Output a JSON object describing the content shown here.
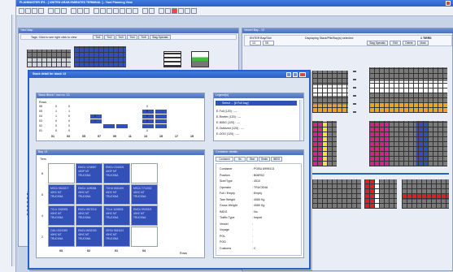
{
  "app": {
    "title": "PLANMASTER IFS - [ UNITED ARAB EMIRATES TERMINAL ] - Yard Planning View"
  },
  "yard_map": {
    "title": "Yard Map",
    "tabs_hint": "Tags: Click to see right click to view",
    "tabs": [
      "Tm1",
      "Tm2",
      "Tm3",
      "Tm4",
      "Tm5",
      "Stag Specials"
    ]
  },
  "bay_view": {
    "title": "Vessel Bay - 13",
    "search_label": "ENTER Bay/Slot",
    "row_values": [
      "13",
      "06"
    ],
    "status": "Displaying Stack/Pile/Bay(s) selected",
    "bay_count": "1 TIERS",
    "buttons": [
      "Stag Specials",
      "Edit",
      "Delete",
      "Mark"
    ]
  },
  "dialog": {
    "title": "Stack detail for block 13",
    "stack_panel": {
      "title": "Stack Block / row no. 13",
      "header_label": "Rows",
      "rows": [
        {
          "label": "06",
          "values": [
            "0",
            "0",
            "",
            "",
            "",
            "",
            "",
            "0",
            "",
            "",
            ""
          ]
        },
        {
          "label": "05",
          "values": [
            "1",
            "1",
            "",
            "",
            "",
            "",
            "",
            "0",
            "",
            "",
            ""
          ]
        },
        {
          "label": "04",
          "values": [
            "1",
            "0",
            "",
            "0",
            "",
            "",
            "",
            "0",
            "",
            "",
            ""
          ]
        },
        {
          "label": "03",
          "values": [
            "0",
            "0",
            "",
            "1",
            "",
            "",
            "",
            "0",
            "",
            "",
            ""
          ]
        },
        {
          "label": "02",
          "values": [
            "0",
            "0",
            "",
            "",
            "",
            "",
            "",
            "",
            "",
            "",
            ""
          ]
        },
        {
          "label": "01",
          "values": [
            "0",
            "0",
            "",
            "",
            "",
            "",
            "",
            "0",
            "",
            "",
            ""
          ]
        }
      ],
      "columns": [
        "01",
        "03",
        "05",
        "07",
        "09",
        "11",
        "13",
        "15",
        "17",
        "19"
      ]
    },
    "legend_panel": {
      "title": "Legend(s)",
      "selected": "Select ... [6 Full bay]",
      "items": [
        "E-Full (120)   :  ---",
        "E-Reefer (120) :  ---",
        "E-IMDG (120)   :  ---",
        "E-Outsized (120) :  ---",
        "E-OOG (120)    :  ---"
      ]
    },
    "bay_panel": {
      "title": "Bay 13",
      "tiers_label": "Tiers",
      "tier_numbers": [
        "8",
        "6",
        "4",
        "2"
      ],
      "row_numbers": [
        "03",
        "02",
        "01",
        "04"
      ],
      "rows_label": "Rows",
      "cell_texts": [
        [
          "",
          "EMCU 1234567\n40GP MT\nTRUCKNA",
          "EMCU 2344321\n40GP MT\nTRUCKNA",
          ""
        ],
        [
          "MSCU 5521877\n40HC MT\nTRUCKNA",
          "EMCU 1199284\n40HC MT\nTRUCKNA",
          "TGHU 6611200\n40HC MT\nTRUCKNA",
          "MSCU 7711002\n40HC MT\nTRUCKNA"
        ],
        [
          "TCLU 3320991\n40HC MT\nTRUCKNA",
          "EMCU 8872210\n40HC MT\nTRUCKNA",
          "TCLU 1128833\n40HC MT\nTRUCKNA",
          "EMCU 9903321\n40HC MT\nTRUCKNA"
        ],
        [
          "CAIU 2021009\n40HC MT\nTRUCKNA",
          "EMCU 6632190\n40HC MT\nTRUCKNA",
          "GESU 5541122\n40HC MT\nTRUCKNA",
          ""
        ]
      ]
    },
    "detail_panel": {
      "title": "Container details",
      "tabs": [
        "Container",
        "Its",
        "Stat",
        "Seals",
        "IMDG"
      ],
      "fields": [
        {
          "label": "Container",
          "value": "POBU 8999413"
        },
        {
          "label": "Position",
          "value": "B06R02"
        },
        {
          "label": "Size/Type",
          "value": "4510"
        },
        {
          "label": "Operator",
          "value": "TRUCKNA"
        },
        {
          "label": "Full / Empty",
          "value": "Empty"
        },
        {
          "label": "Tare Weight",
          "value": "4080 Kg"
        },
        {
          "label": "Gross Weight",
          "value": "4080 Kg"
        },
        {
          "label": "IMDG",
          "value": "No"
        },
        {
          "label": "Traffic Type",
          "value": "Import"
        },
        {
          "label": "Vessel",
          "value": ""
        },
        {
          "label": "Voyage",
          "value": ""
        },
        {
          "label": "POL",
          "value": ""
        },
        {
          "label": "POD",
          "value": ""
        },
        {
          "label": "Customs",
          "value": "C"
        }
      ]
    }
  },
  "colors": {
    "selected": "#3250b8",
    "empty": "#ffffff",
    "title_bar": "#2a5fc6",
    "reefer": "#f2a21c",
    "imdg": "#d6238c",
    "hazard": "#e02020"
  }
}
